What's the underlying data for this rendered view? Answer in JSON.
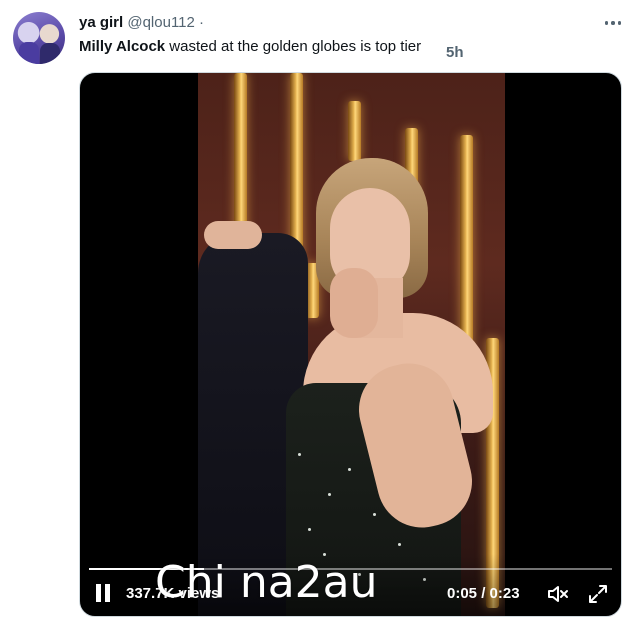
{
  "tweet": {
    "display_name": "ya girl",
    "handle": "@qlou112",
    "separator": "·",
    "time": "5h",
    "text_bold": "Milly Alcock",
    "text_rest": " wasted at the golden globes is top tier",
    "more_icon": "more-horizontal-icon"
  },
  "video": {
    "views": "337.7K views",
    "elapsed": "0:05",
    "duration": "0:23",
    "time_separator": " / ",
    "progress": 0.22,
    "play_state_icon": "pause-icon",
    "mute_icon": "volume-muted-icon",
    "fullscreen_icon": "fullscreen-icon"
  },
  "watermark": "Chi na2au",
  "colors": {
    "text_primary": "#0f1419",
    "text_secondary": "#536471",
    "media_border": "#cfd9de"
  }
}
